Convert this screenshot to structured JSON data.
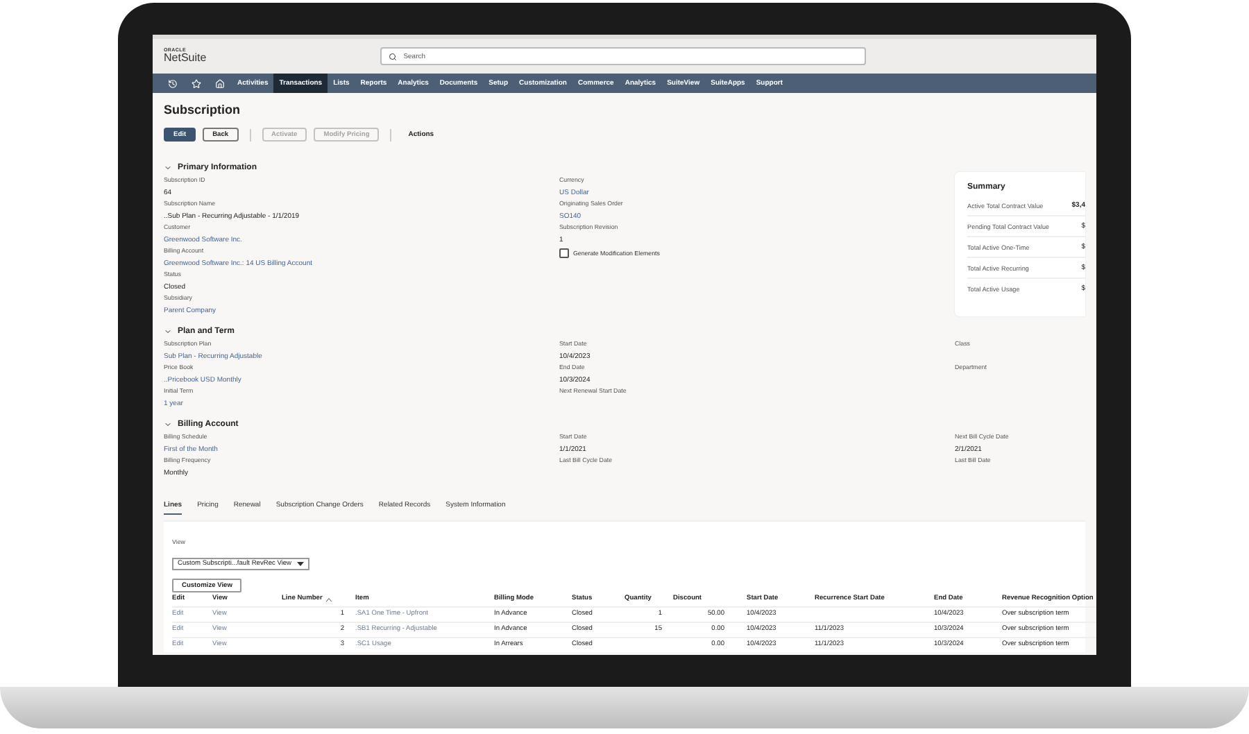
{
  "header": {
    "logo_top": "ORACLE",
    "logo": "NetSuite",
    "search": {
      "placeholder": "Search"
    }
  },
  "nav": {
    "items": [
      {
        "label": "Activities",
        "selected": false
      },
      {
        "label": "Transactions",
        "selected": true
      },
      {
        "label": "Lists",
        "selected": false
      },
      {
        "label": "Reports",
        "selected": false
      },
      {
        "label": "Analytics",
        "selected": false
      },
      {
        "label": "Documents",
        "selected": false
      },
      {
        "label": "Setup",
        "selected": false
      },
      {
        "label": "Customization",
        "selected": false
      },
      {
        "label": "Commerce",
        "selected": false
      },
      {
        "label": "Analytics",
        "selected": false
      },
      {
        "label": "SuiteView",
        "selected": false
      },
      {
        "label": "SuiteApps",
        "selected": false
      },
      {
        "label": "Support",
        "selected": false
      }
    ]
  },
  "page": {
    "title": "Subscription",
    "button_groups": [
      [
        {
          "label": "Edit",
          "kind": "primary",
          "disabled": false
        },
        {
          "label": "Back",
          "kind": "secondary",
          "disabled": false
        }
      ],
      [
        {
          "label": "Activate",
          "kind": "secondary",
          "disabled": true
        },
        {
          "label": "Modify Pricing",
          "kind": "secondary",
          "disabled": true
        }
      ]
    ],
    "actions": "Actions"
  },
  "sections": [
    {
      "title": "Primary Information",
      "expanded": true,
      "columns": [
        {
          "kind": "fields",
          "items": [
            {
              "kind": "field",
              "label": "Subscription ID",
              "value": "64",
              "link": false
            },
            {
              "kind": "field",
              "label": "Subscription Name",
              "value": "..Sub Plan - Recurring Adjustable - 1/1/2019",
              "link": false
            },
            {
              "kind": "field",
              "label": "Customer",
              "value": "Greenwood Software Inc.",
              "link": true
            },
            {
              "kind": "field",
              "label": "Billing Account",
              "value": "Greenwood Software Inc.: 14 US Billing Account",
              "link": true
            },
            {
              "kind": "field",
              "label": "Status",
              "value": "Closed",
              "link": false
            },
            {
              "kind": "field",
              "label": "Subsidiary",
              "value": "Parent Company",
              "link": true
            }
          ]
        },
        {
          "kind": "fields",
          "items": [
            {
              "kind": "field",
              "label": "Currency",
              "value": "US Dollar",
              "link": true
            },
            {
              "kind": "field",
              "label": "Originating Sales Order",
              "value": "SO140",
              "link": true
            },
            {
              "kind": "field",
              "label": "Subscription Revision",
              "value": "1",
              "link": false
            },
            {
              "kind": "checkbox",
              "label": "Generate Modification Elements",
              "checked": false
            }
          ]
        },
        {
          "kind": "summary",
          "title": "Summary",
          "rows": [
            {
              "label": "Active Total Contract Value",
              "value": "$3,4",
              "bold": true
            },
            {
              "label": "Pending Total Contract Value",
              "value": "$",
              "bold": false
            },
            {
              "label": "Total Active One-Time",
              "value": "$",
              "bold": false
            },
            {
              "label": "Total Active Recurring",
              "value": "$",
              "bold": false
            },
            {
              "label": "Total Active Usage",
              "value": "$",
              "bold": false
            }
          ]
        }
      ]
    },
    {
      "title": "Plan and Term",
      "expanded": true,
      "columns": [
        {
          "kind": "fields",
          "items": [
            {
              "kind": "field",
              "label": "Subscription Plan",
              "value": "Sub Plan - Recurring Adjustable",
              "link": true
            },
            {
              "kind": "field",
              "label": "Price Book",
              "value": "..Pricebook USD Monthly",
              "link": true
            },
            {
              "kind": "field",
              "label": "Initial Term",
              "value": "1 year",
              "link": true
            }
          ]
        },
        {
          "kind": "fields",
          "items": [
            {
              "kind": "field",
              "label": "Start Date",
              "value": "10/4/2023",
              "link": false
            },
            {
              "kind": "field",
              "label": "End Date",
              "value": "10/3/2024",
              "link": false
            },
            {
              "kind": "field",
              "label": "Next Renewal Start Date"
            }
          ]
        },
        {
          "kind": "fields",
          "items": [
            {
              "kind": "field",
              "label": "Class"
            },
            {
              "kind": "field",
              "label": "Department"
            }
          ]
        }
      ]
    },
    {
      "title": "Billing Account",
      "expanded": true,
      "columns": [
        {
          "kind": "fields",
          "items": [
            {
              "kind": "field",
              "label": "Billing Schedule",
              "value": "First of the Month",
              "link": true
            },
            {
              "kind": "field",
              "label": "Billing Frequency",
              "value": "Monthly",
              "link": false
            }
          ]
        },
        {
          "kind": "fields",
          "items": [
            {
              "kind": "field",
              "label": "Start Date",
              "value": "1/1/2021",
              "link": false
            },
            {
              "kind": "field",
              "label": "Last Bill Cycle Date"
            }
          ]
        },
        {
          "kind": "fields",
          "items": [
            {
              "kind": "field",
              "label": "Next Bill Cycle Date",
              "value": "2/1/2021",
              "link": false
            },
            {
              "kind": "field",
              "label": "Last Bill Date"
            }
          ]
        }
      ]
    }
  ],
  "tabs": [
    {
      "label": "Lines",
      "selected": true
    },
    {
      "label": "Pricing",
      "selected": false
    },
    {
      "label": "Renewal",
      "selected": false
    },
    {
      "label": "Subscription Change Orders",
      "selected": false
    },
    {
      "label": "Related Records",
      "selected": false
    },
    {
      "label": "System Information",
      "selected": false
    }
  ],
  "lines": {
    "view_label": "View",
    "view_select": "Custom Subscripti...fault RevRec View",
    "customize_button": "Customize View",
    "columns": [
      {
        "label": "Edit",
        "kind": "link"
      },
      {
        "label": "View",
        "kind": "link"
      },
      {
        "label": "Line Number",
        "kind": "number",
        "sorted": true
      },
      {
        "label": "Item",
        "kind": "link"
      },
      {
        "label": "Billing Mode",
        "kind": "text"
      },
      {
        "label": "Status",
        "kind": "text"
      },
      {
        "label": "Quantity",
        "kind": "number"
      },
      {
        "label": "Discount",
        "kind": "number"
      },
      {
        "label": "Start Date",
        "kind": "text"
      },
      {
        "label": "Recurrence Start Date",
        "kind": "text"
      },
      {
        "label": "End Date",
        "kind": "text"
      },
      {
        "label": "Revenue Recognition Option",
        "kind": "text"
      }
    ],
    "rows": [
      [
        "Edit",
        "View",
        "1",
        ".SA1 One Time - Upfront",
        "In Advance",
        "Closed",
        "1",
        "50.00",
        "10/4/2023",
        null,
        "10/4/2023",
        "Over subscription term"
      ],
      [
        "Edit",
        "View",
        "2",
        ".SB1 Recurring - Adjustable",
        "In Advance",
        "Closed",
        "15",
        "0.00",
        "10/4/2023",
        "11/1/2023",
        "10/3/2024",
        "Over subscription term"
      ],
      [
        "Edit",
        "View",
        "3",
        ".SC1 Usage",
        "In Arrears",
        "Closed",
        null,
        "0.00",
        "10/4/2023",
        "11/1/2023",
        "10/3/2024",
        "Over subscription term"
      ]
    ]
  }
}
